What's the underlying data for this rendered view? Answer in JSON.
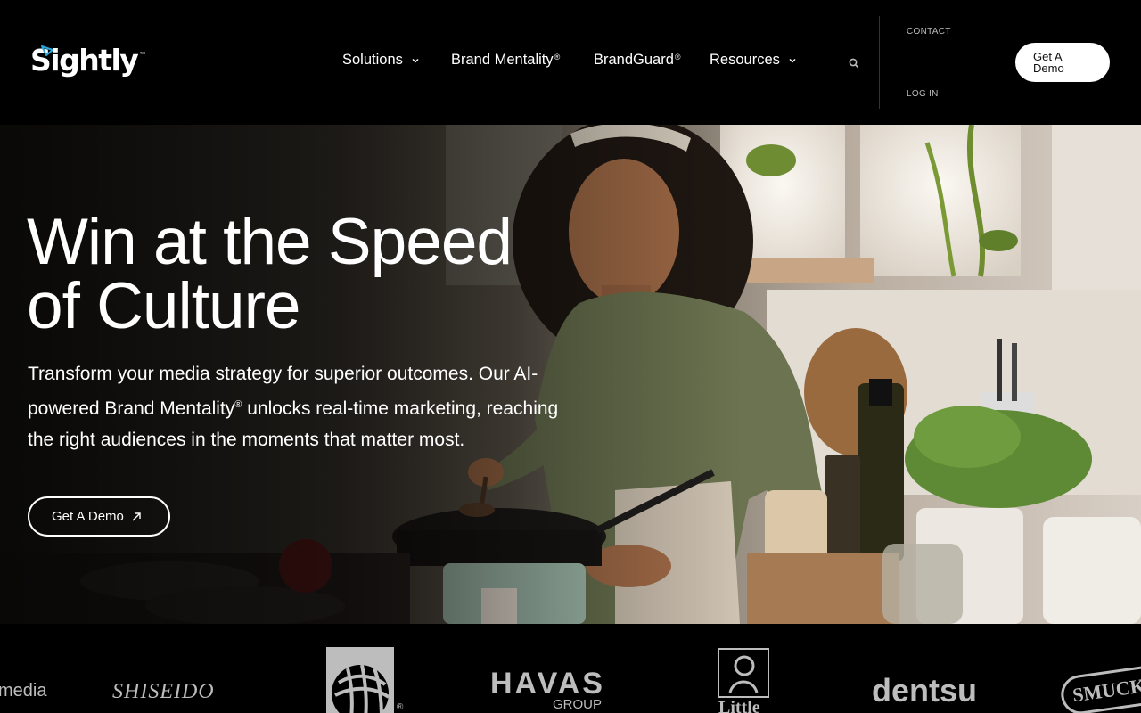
{
  "brand": {
    "name": "Sightly",
    "trademark": "™"
  },
  "nav": {
    "items": [
      {
        "label": "Solutions",
        "mark": "",
        "dropdown": true
      },
      {
        "label": "Brand Mentality",
        "mark": "®",
        "dropdown": false
      },
      {
        "label": "BrandGuard",
        "mark": "®",
        "dropdown": false
      },
      {
        "label": "Resources",
        "mark": "",
        "dropdown": true
      }
    ],
    "search_icon": "search-icon"
  },
  "utility": {
    "contact": "CONTACT",
    "login": "LOG IN",
    "demo_line1": "Get A",
    "demo_line2": "Demo"
  },
  "hero": {
    "title_line1": "Win at the Speed",
    "title_line2": "of Culture",
    "sub_part1": "Transform your media strategy for superior outcomes. Our AI-powered Brand Mentality",
    "sub_mark": "®",
    "sub_part2": " unlocks real-time marketing, reaching the right audiences in the moments that matter most.",
    "cta_label": "Get A Demo",
    "cta_icon": "arrow-up-right-icon"
  },
  "client_logos": {
    "media": "media",
    "shiseido": "SHISEIDO",
    "united_mark": "®",
    "havas": "HAVAS",
    "havas_sub": "GROUP",
    "little": "Little",
    "dentsu": "dentsu",
    "smuckers": "SMUCKE"
  },
  "colors": {
    "header_bg": "#000000",
    "button_bg": "#ffffff",
    "button_text": "#111111",
    "logo_grey": "#bdbdbd"
  }
}
